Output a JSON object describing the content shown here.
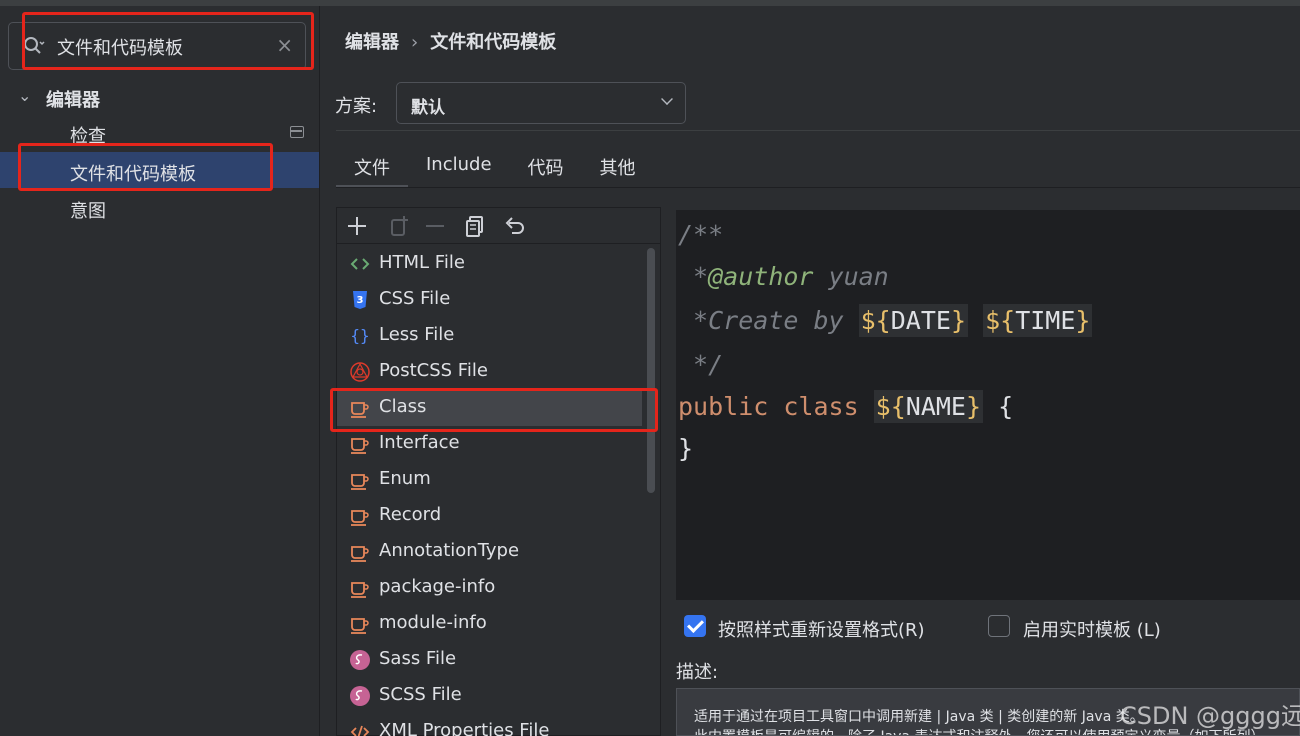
{
  "search": {
    "value": "文件和代码模板",
    "clear_label": "×"
  },
  "tree": {
    "parent": "编辑器",
    "items": [
      {
        "label": "检查"
      },
      {
        "label": "文件和代码模板"
      },
      {
        "label": "意图"
      }
    ]
  },
  "breadcrumb": {
    "first": "编辑器",
    "separator": "›",
    "second": "文件和代码模板"
  },
  "scheme": {
    "label": "方案:",
    "value": "默认"
  },
  "tabs": [
    {
      "label": "文件"
    },
    {
      "label": "Include"
    },
    {
      "label": "代码"
    },
    {
      "label": "其他"
    }
  ],
  "files": [
    {
      "label": "HTML File",
      "icon": "html-icon"
    },
    {
      "label": "CSS File",
      "icon": "css-icon"
    },
    {
      "label": "Less File",
      "icon": "less-icon"
    },
    {
      "label": "PostCSS File",
      "icon": "postcss-icon"
    },
    {
      "label": "Class",
      "icon": "java-icon"
    },
    {
      "label": "Interface",
      "icon": "java-icon"
    },
    {
      "label": "Enum",
      "icon": "java-icon"
    },
    {
      "label": "Record",
      "icon": "java-icon"
    },
    {
      "label": "AnnotationType",
      "icon": "java-icon"
    },
    {
      "label": "package-info",
      "icon": "java-icon"
    },
    {
      "label": "module-info",
      "icon": "java-icon"
    },
    {
      "label": "Sass File",
      "icon": "sass-icon"
    },
    {
      "label": "SCSS File",
      "icon": "sass-icon"
    },
    {
      "label": "XML Properties File",
      "icon": "xml-icon"
    }
  ],
  "code": {
    "l1": "/**",
    "l2_star": " *",
    "l2_tag": "@author",
    "l2_rest": " yuan",
    "l3_text": " *Create by ",
    "l3_var1": "DATE",
    "l3_var2": "TIME",
    "l4": " */",
    "l5_kw": "public class ",
    "l5_var": "NAME",
    "l5_rest": " {",
    "l6": "}"
  },
  "options": {
    "reformat": "按照样式重新设置格式(R)",
    "live_template": "启用实时模板 (L)"
  },
  "description": {
    "label": "描述:",
    "line1": "适用于通过在项目工具窗口中调用新建 | Java 类 | 类创建的新 Java 类。",
    "line2": "此内置模板是可编辑的。除了 Java 表达式和注释外，您还可以使用预定义变量（如下所列）"
  },
  "watermark": "CSDN @gggg远",
  "colors": {
    "selection": "#2e436e",
    "highlight_box": "#e5251b",
    "checkbox": "#3574f0"
  }
}
